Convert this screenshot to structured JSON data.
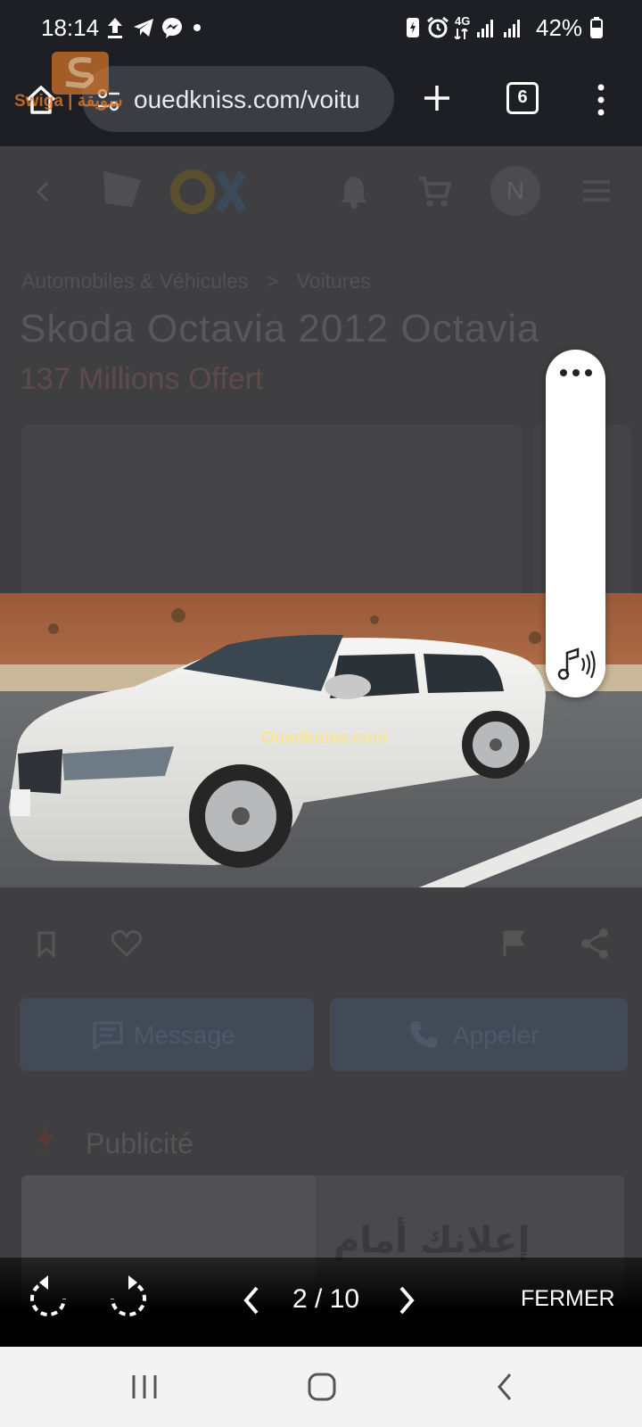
{
  "status_bar": {
    "time": "18:14",
    "network": "4G",
    "battery_percent": "42%"
  },
  "browser": {
    "url": "ouedkniss.com/voitu",
    "tab_count": "6",
    "watermark": "Swiga | سويقة"
  },
  "page": {
    "breadcrumb_parent": "Automobiles & Véhicules",
    "breadcrumb_separator": ">",
    "breadcrumb_current": "Voitures",
    "title": "Skoda Octavia 2012 Octavia",
    "price": "137 Millions Offert",
    "header_avatar": "N",
    "message_button": "Message",
    "call_button": "Appeler",
    "ad_section_label": "Publicité",
    "ad_text": "إعلانك أمام"
  },
  "photo": {
    "watermark": "Ouedkniss.com"
  },
  "viewer": {
    "counter": "2 / 10",
    "close_label": "FERMER"
  },
  "colors": {
    "status_bar_bg": "#1d1f24",
    "url_pill_bg": "#3a3d44",
    "page_dim": "#3f3f41",
    "nav_bar_bg": "#f3f3f3"
  }
}
